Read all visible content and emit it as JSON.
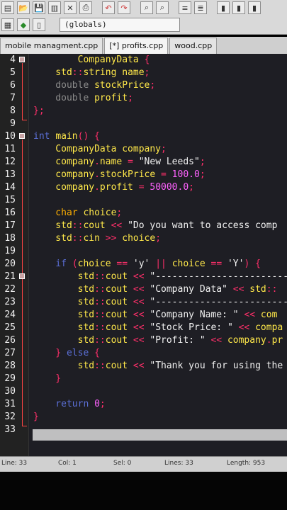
{
  "toolbar": {
    "globals_label": "(globals)"
  },
  "tabs": [
    {
      "label": "mobile managment.cpp",
      "active": false
    },
    {
      "label": "[*] profits.cpp",
      "active": true
    },
    {
      "label": "wood.cpp",
      "active": false
    }
  ],
  "lines": [
    {
      "num": "4",
      "parts": [
        [
          "id",
          "        CompanyData "
        ],
        [
          "op",
          "{"
        ]
      ]
    },
    {
      "num": "5",
      "parts": [
        [
          "id",
          "    std"
        ],
        [
          "op",
          "::"
        ],
        [
          "id",
          "string name"
        ],
        [
          "op",
          ";"
        ]
      ]
    },
    {
      "num": "6",
      "parts": [
        [
          "cm",
          "    double "
        ],
        [
          "id",
          "stockPrice"
        ],
        [
          "op",
          ";"
        ]
      ]
    },
    {
      "num": "7",
      "parts": [
        [
          "cm",
          "    double "
        ],
        [
          "id",
          "profit"
        ],
        [
          "op",
          ";"
        ]
      ]
    },
    {
      "num": "8",
      "parts": [
        [
          "op",
          "};"
        ]
      ]
    },
    {
      "num": "9",
      "parts": [
        [
          "st",
          ""
        ]
      ]
    },
    {
      "num": "10",
      "parts": [
        [
          "kw",
          "int "
        ],
        [
          "id",
          "main"
        ],
        [
          "op",
          "() {"
        ]
      ]
    },
    {
      "num": "11",
      "parts": [
        [
          "id",
          "    CompanyData company"
        ],
        [
          "op",
          ";"
        ]
      ]
    },
    {
      "num": "12",
      "parts": [
        [
          "id",
          "    company"
        ],
        [
          "op",
          "."
        ],
        [
          "id",
          "name "
        ],
        [
          "op",
          "= "
        ],
        [
          "st",
          "\"New Leeds\""
        ],
        [
          "op",
          ";"
        ]
      ]
    },
    {
      "num": "13",
      "parts": [
        [
          "id",
          "    company"
        ],
        [
          "op",
          "."
        ],
        [
          "id",
          "stockPrice "
        ],
        [
          "op",
          "= "
        ],
        [
          "nm",
          "100.0"
        ],
        [
          "op",
          ";"
        ]
      ]
    },
    {
      "num": "14",
      "parts": [
        [
          "id",
          "    company"
        ],
        [
          "op",
          "."
        ],
        [
          "id",
          "profit "
        ],
        [
          "op",
          "= "
        ],
        [
          "nm",
          "50000.0"
        ],
        [
          "op",
          ";"
        ]
      ]
    },
    {
      "num": "15",
      "parts": [
        [
          "st",
          ""
        ]
      ]
    },
    {
      "num": "16",
      "parts": [
        [
          "ty",
          "    char "
        ],
        [
          "id",
          "choice"
        ],
        [
          "op",
          ";"
        ]
      ]
    },
    {
      "num": "17",
      "parts": [
        [
          "id",
          "    std"
        ],
        [
          "op",
          "::"
        ],
        [
          "id",
          "cout "
        ],
        [
          "op",
          "<< "
        ],
        [
          "st",
          "\"Do you want to access comp"
        ]
      ]
    },
    {
      "num": "18",
      "parts": [
        [
          "id",
          "    std"
        ],
        [
          "op",
          "::"
        ],
        [
          "id",
          "cin "
        ],
        [
          "op",
          ">> "
        ],
        [
          "id",
          "choice"
        ],
        [
          "op",
          ";"
        ]
      ]
    },
    {
      "num": "19",
      "parts": [
        [
          "st",
          ""
        ]
      ]
    },
    {
      "num": "20",
      "parts": [
        [
          "kw",
          "    if "
        ],
        [
          "op",
          "("
        ],
        [
          "id",
          "choice "
        ],
        [
          "op",
          "== "
        ],
        [
          "st",
          "'y' "
        ],
        [
          "op",
          "|| "
        ],
        [
          "id",
          "choice "
        ],
        [
          "op",
          "== "
        ],
        [
          "st",
          "'Y'"
        ],
        [
          "op",
          ") {"
        ]
      ]
    },
    {
      "num": "21",
      "parts": [
        [
          "id",
          "        std"
        ],
        [
          "op",
          "::"
        ],
        [
          "id",
          "cout "
        ],
        [
          "op",
          "<< "
        ],
        [
          "st",
          "\"-------------------------"
        ]
      ]
    },
    {
      "num": "22",
      "parts": [
        [
          "id",
          "        std"
        ],
        [
          "op",
          "::"
        ],
        [
          "id",
          "cout "
        ],
        [
          "op",
          "<< "
        ],
        [
          "st",
          "\"Company Data\" "
        ],
        [
          "op",
          "<< "
        ],
        [
          "id",
          "std"
        ],
        [
          "op",
          "::"
        ]
      ]
    },
    {
      "num": "23",
      "parts": [
        [
          "id",
          "        std"
        ],
        [
          "op",
          "::"
        ],
        [
          "id",
          "cout "
        ],
        [
          "op",
          "<< "
        ],
        [
          "st",
          "\"-------------------------"
        ]
      ]
    },
    {
      "num": "24",
      "parts": [
        [
          "id",
          "        std"
        ],
        [
          "op",
          "::"
        ],
        [
          "id",
          "cout "
        ],
        [
          "op",
          "<< "
        ],
        [
          "st",
          "\"Company Name: \" "
        ],
        [
          "op",
          "<< "
        ],
        [
          "id",
          "com"
        ]
      ]
    },
    {
      "num": "25",
      "parts": [
        [
          "id",
          "        std"
        ],
        [
          "op",
          "::"
        ],
        [
          "id",
          "cout "
        ],
        [
          "op",
          "<< "
        ],
        [
          "st",
          "\"Stock Price: \" "
        ],
        [
          "op",
          "<< "
        ],
        [
          "id",
          "compa"
        ]
      ]
    },
    {
      "num": "26",
      "parts": [
        [
          "id",
          "        std"
        ],
        [
          "op",
          "::"
        ],
        [
          "id",
          "cout "
        ],
        [
          "op",
          "<< "
        ],
        [
          "st",
          "\"Profit: \" "
        ],
        [
          "op",
          "<< "
        ],
        [
          "id",
          "company"
        ],
        [
          "op",
          "."
        ],
        [
          "id",
          "pr"
        ]
      ]
    },
    {
      "num": "27",
      "parts": [
        [
          "op",
          "    } "
        ],
        [
          "kw",
          "else "
        ],
        [
          "op",
          "{"
        ]
      ]
    },
    {
      "num": "28",
      "parts": [
        [
          "id",
          "        std"
        ],
        [
          "op",
          "::"
        ],
        [
          "id",
          "cout "
        ],
        [
          "op",
          "<< "
        ],
        [
          "st",
          "\"Thank you for using the"
        ]
      ]
    },
    {
      "num": "29",
      "parts": [
        [
          "op",
          "    }"
        ]
      ]
    },
    {
      "num": "30",
      "parts": [
        [
          "st",
          ""
        ]
      ]
    },
    {
      "num": "31",
      "parts": [
        [
          "kw",
          "    return "
        ],
        [
          "nm",
          "0"
        ],
        [
          "op",
          ";"
        ]
      ]
    },
    {
      "num": "32",
      "parts": [
        [
          "op",
          "}"
        ]
      ]
    },
    {
      "num": "33",
      "parts": [
        [
          "st",
          ""
        ]
      ]
    }
  ],
  "status": {
    "line": "Line:  33",
    "col": "Col:   1",
    "sel": "Sel:   0",
    "lines": "Lines:  33",
    "length": "Length:  953"
  }
}
